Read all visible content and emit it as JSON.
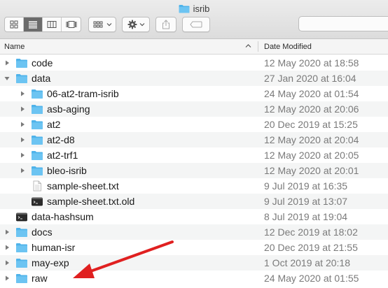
{
  "window": {
    "title": "isrib"
  },
  "columns": {
    "name": "Name",
    "date_modified": "Date Modified"
  },
  "colors": {
    "accent_folder": "#4fb3ea",
    "annotation_arrow": "#e02020",
    "row_alt": "#f4f5f5"
  },
  "toolbar": {
    "view_buttons": [
      "icon-view-icon",
      "list-view-icon",
      "column-view-icon",
      "gallery-view-icon"
    ],
    "active_view": "list-view-icon",
    "group_button": "group-by-icon",
    "action_button": "gear-icon",
    "share_button": "share-icon",
    "tags_button": "tag-icon"
  },
  "rows": [
    {
      "name": "code",
      "date": "12 May 2020 at 18:58",
      "type": "folder",
      "depth": 0,
      "expanded": false
    },
    {
      "name": "data",
      "date": "27 Jan 2020 at 16:04",
      "type": "folder",
      "depth": 0,
      "expanded": true
    },
    {
      "name": "06-at2-tram-isrib",
      "date": "24 May 2020 at 01:54",
      "type": "folder",
      "depth": 1,
      "expanded": false
    },
    {
      "name": "asb-aging",
      "date": "12 May 2020 at 20:06",
      "type": "folder",
      "depth": 1,
      "expanded": false
    },
    {
      "name": "at2",
      "date": "20 Dec 2019 at 15:25",
      "type": "folder",
      "depth": 1,
      "expanded": false
    },
    {
      "name": "at2-d8",
      "date": "12 May 2020 at 20:04",
      "type": "folder",
      "depth": 1,
      "expanded": false
    },
    {
      "name": "at2-trf1",
      "date": "12 May 2020 at 20:05",
      "type": "folder",
      "depth": 1,
      "expanded": false
    },
    {
      "name": "bleo-isrib",
      "date": "12 May 2020 at 20:01",
      "type": "folder",
      "depth": 1,
      "expanded": false
    },
    {
      "name": "sample-sheet.txt",
      "date": "9 Jul 2019 at 16:35",
      "type": "text",
      "depth": 1
    },
    {
      "name": "sample-sheet.txt.old",
      "date": "9 Jul 2019 at 13:07",
      "type": "exec",
      "depth": 1
    },
    {
      "name": "data-hashsum",
      "date": "8 Jul 2019 at 19:04",
      "type": "exec",
      "depth": 0
    },
    {
      "name": "docs",
      "date": "12 Dec 2019 at 18:02",
      "type": "folder",
      "depth": 0,
      "expanded": false
    },
    {
      "name": "human-isr",
      "date": "20 Dec 2019 at 21:55",
      "type": "folder",
      "depth": 0,
      "expanded": false
    },
    {
      "name": "may-exp",
      "date": "1 Oct 2019 at 20:18",
      "type": "folder",
      "depth": 0,
      "expanded": false
    },
    {
      "name": "raw",
      "date": "24 May 2020 at 01:55",
      "type": "folder",
      "depth": 0,
      "expanded": false
    }
  ]
}
